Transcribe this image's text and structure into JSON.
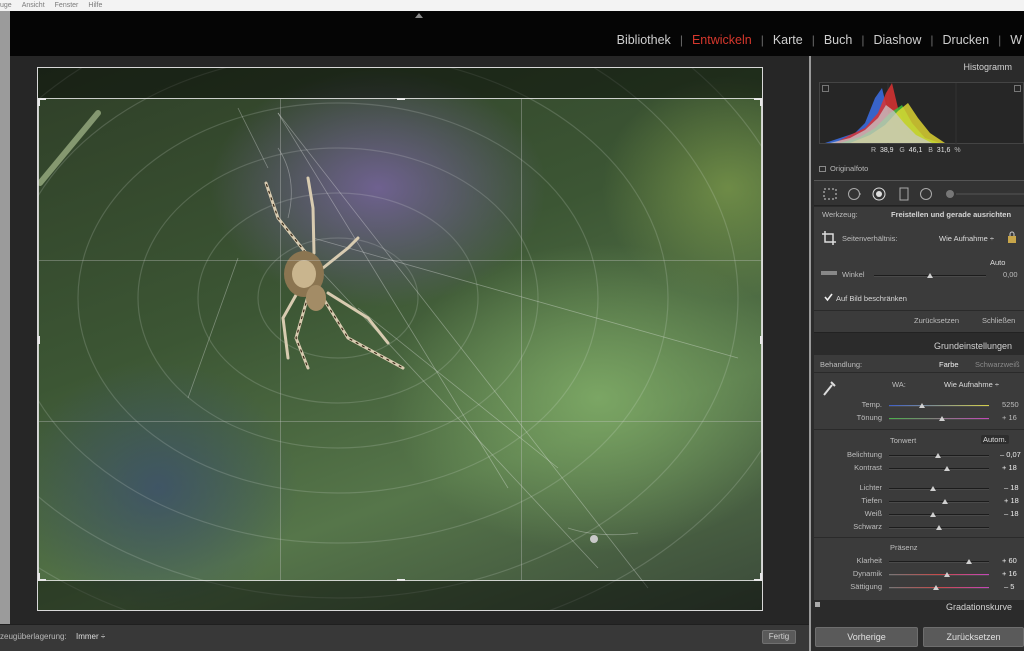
{
  "menubar": {
    "items": [
      "uge",
      "Ansicht",
      "Fenster",
      "Hilfe"
    ]
  },
  "modules": {
    "items": [
      {
        "label": "Bibliothek",
        "active": false
      },
      {
        "label": "Entwickeln",
        "active": true
      },
      {
        "label": "Karte",
        "active": false
      },
      {
        "label": "Buch",
        "active": false
      },
      {
        "label": "Diashow",
        "active": false
      },
      {
        "label": "Drucken",
        "active": false
      },
      {
        "label": "W",
        "active": false
      }
    ],
    "separator": "|",
    "active_color": "#d6382d"
  },
  "toolbar": {
    "overlay_label": "zeugüberlagerung:",
    "overlay_value": "Immer ÷",
    "done_label": "Fertig"
  },
  "histogram": {
    "title": "Histogramm",
    "r_label": "R",
    "r_value": "38,9",
    "g_label": "G",
    "g_value": "46,1",
    "b_label": "B",
    "b_value": "31,6",
    "unit": "%",
    "original_label": "Originalfoto"
  },
  "crop_panel": {
    "tool_label": "Werkzeug:",
    "tool_value": "Freistellen und gerade ausrichten",
    "aspect_label": "Seitenverhältnis:",
    "aspect_value": "Wie Aufnahme ÷",
    "auto_label": "Auto",
    "angle_label": "Winkel",
    "angle_value": "0,00",
    "angle_level": 0.5,
    "constrain_label": "Auf Bild beschränken",
    "constrain_checked": true,
    "reset_label": "Zurücksetzen",
    "close_label": "Schließen"
  },
  "basic_panel": {
    "title": "Grundeinstellungen",
    "treatment_label": "Behandlung:",
    "treatment_color": "Farbe",
    "treatment_bw": "Schwarzweiß",
    "wb_label": "WA:",
    "wb_value": "Wie Aufnahme ÷",
    "sliders_wb": [
      {
        "label": "Temp.",
        "value": "5250",
        "level": 0.33
      },
      {
        "label": "Tönung",
        "value": "+ 16",
        "level": 0.53
      }
    ],
    "tone_title": "Tonwert",
    "tone_auto": "Autom.",
    "sliders_tone": [
      {
        "label": "Belichtung",
        "value": "– 0,07",
        "level": 0.49
      },
      {
        "label": "Kontrast",
        "value": "+ 18",
        "level": 0.58
      }
    ],
    "sliders_tone2": [
      {
        "label": "Lichter",
        "value": "– 18",
        "level": 0.44
      },
      {
        "label": "Tiefen",
        "value": "+ 18",
        "level": 0.56
      },
      {
        "label": "Weiß",
        "value": "– 18",
        "level": 0.44
      },
      {
        "label": "Schwarz",
        "value": "",
        "level": 0.5
      }
    ],
    "presence_title": "Präsenz",
    "sliders_presence": [
      {
        "label": "Klarheit",
        "value": "+ 60",
        "level": 0.8
      },
      {
        "label": "Dynamik",
        "value": "+ 16",
        "level": 0.58
      },
      {
        "label": "Sättigung",
        "value": "– 5",
        "level": 0.47
      }
    ]
  },
  "curve_panel": {
    "title": "Gradationskurve"
  },
  "bottom_buttons": {
    "previous": "Vorherige",
    "reset": "Zurücksetzen"
  },
  "colors": {
    "active_module": "#d6382d",
    "panel_bg": "#3b3b3b",
    "canvas_bg": "#262626"
  }
}
